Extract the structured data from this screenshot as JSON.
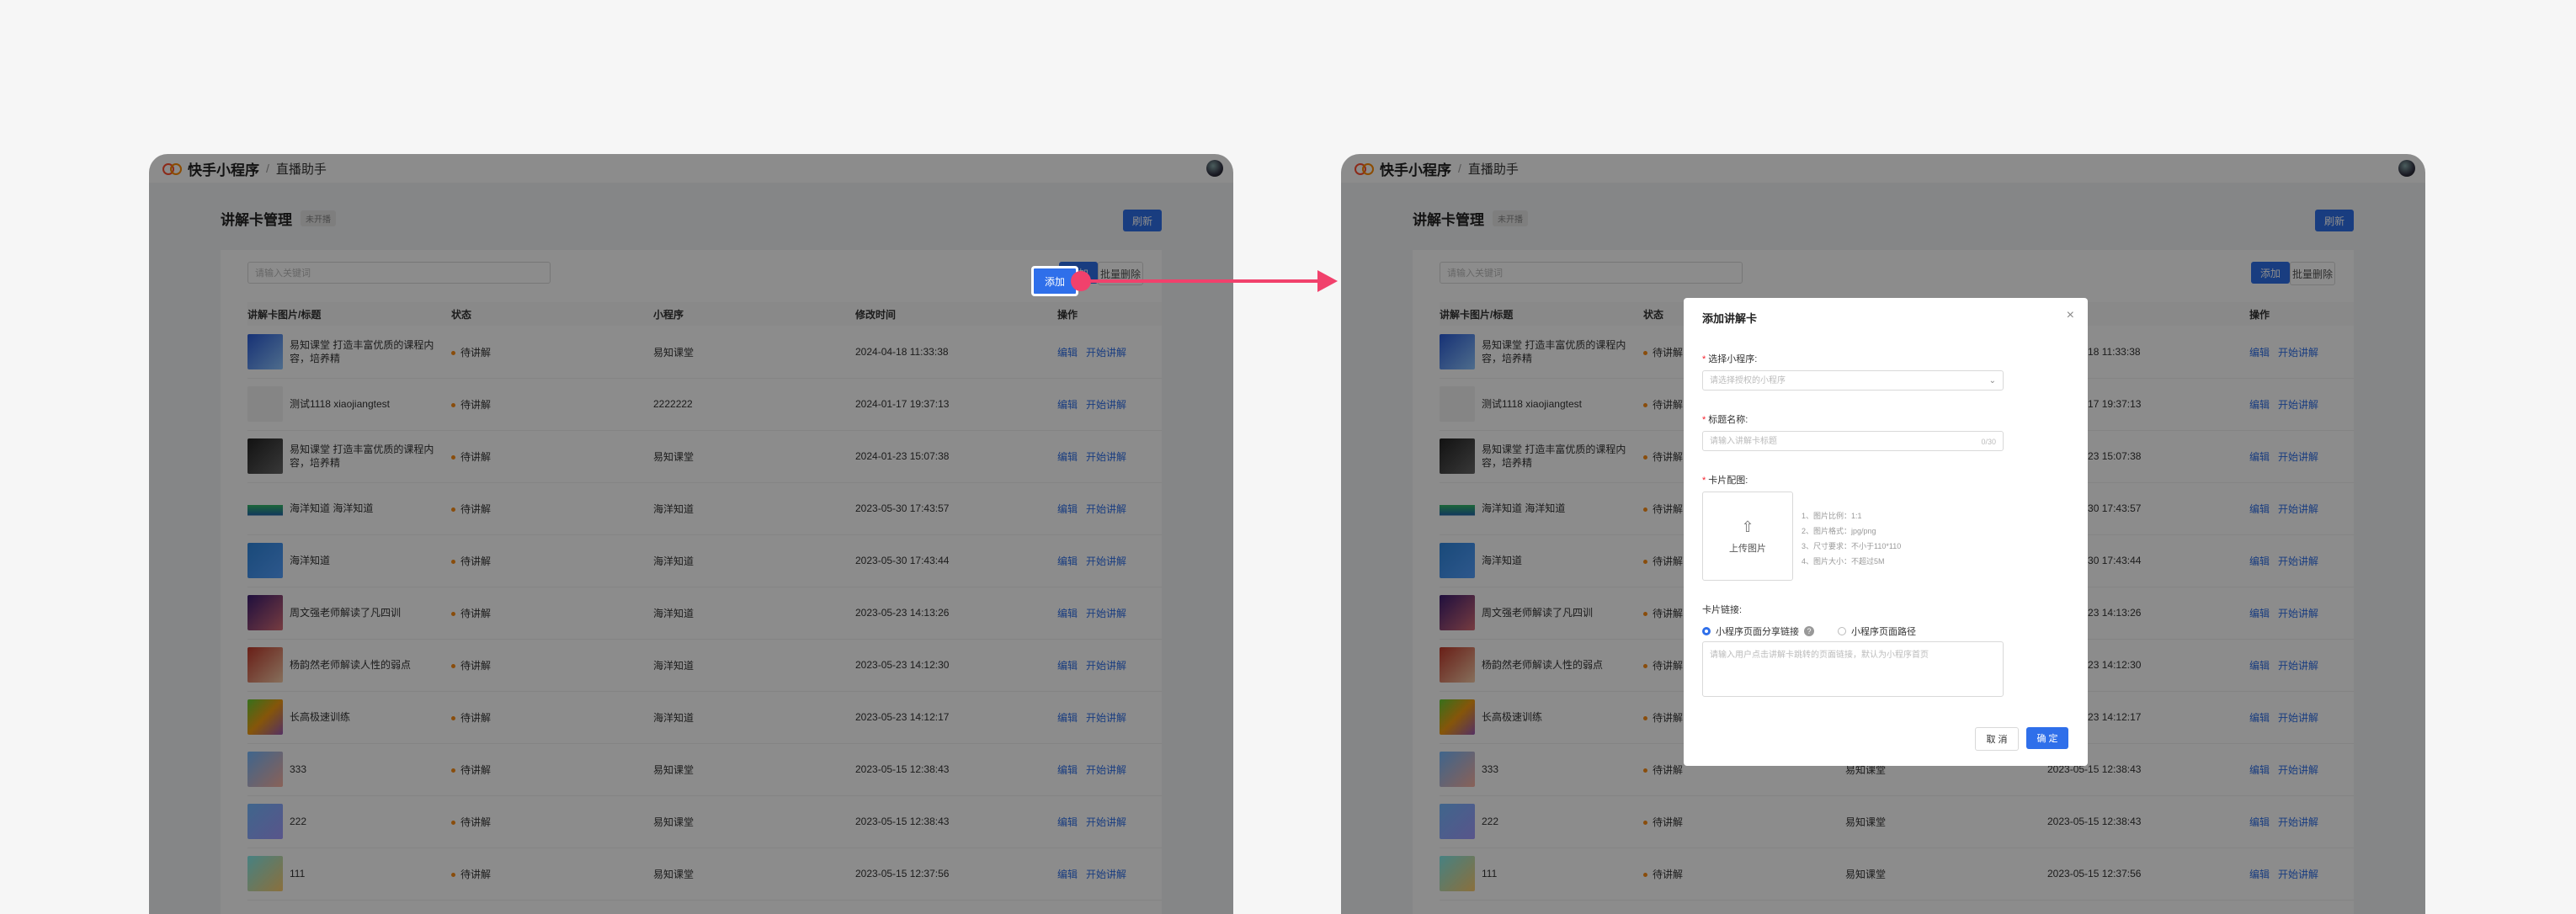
{
  "app": {
    "name": "快手小程序",
    "crumb": "直播助手"
  },
  "page": {
    "title": "讲解卡管理",
    "tag": "未开播",
    "refresh": "刷新"
  },
  "toolbar": {
    "search_placeholder": "请输入关键词",
    "add": "添加",
    "batch_delete": "批量删除"
  },
  "table": {
    "headers": [
      "讲解卡图片/标题",
      "状态",
      "小程序",
      "修改时间",
      "操作"
    ],
    "actions": [
      "编辑",
      "开始讲解"
    ],
    "rows": [
      {
        "title": "易知课堂 打造丰富优质的课程内容，培养精",
        "status": "待讲解",
        "app": "易知课堂",
        "time": "2024-04-18 11:33:38"
      },
      {
        "title": "测试1118 xiaojiangtest",
        "status": "待讲解",
        "app": "2222222",
        "time": "2024-01-17 19:37:13"
      },
      {
        "title": "易知课堂 打造丰富优质的课程内容，培养精",
        "status": "待讲解",
        "app": "易知课堂",
        "time": "2024-01-23 15:07:38"
      },
      {
        "title": "海洋知道 海洋知道",
        "status": "待讲解",
        "app": "海洋知道",
        "time": "2023-05-30 17:43:57"
      },
      {
        "title": "海洋知道",
        "status": "待讲解",
        "app": "海洋知道",
        "time": "2023-05-30 17:43:44"
      },
      {
        "title": "周文强老师解读了凡四训",
        "status": "待讲解",
        "app": "海洋知道",
        "time": "2023-05-23 14:13:26"
      },
      {
        "title": "杨韵然老师解读人性的弱点",
        "status": "待讲解",
        "app": "海洋知道",
        "time": "2023-05-23 14:12:30"
      },
      {
        "title": "长高极速训练",
        "status": "待讲解",
        "app": "海洋知道",
        "time": "2023-05-23 14:12:17"
      },
      {
        "title": "333",
        "status": "待讲解",
        "app": "易知课堂",
        "time": "2023-05-15 12:38:43"
      },
      {
        "title": "222",
        "status": "待讲解",
        "app": "易知课堂",
        "time": "2023-05-15 12:38:43"
      },
      {
        "title": "111",
        "status": "待讲解",
        "app": "易知课堂",
        "time": "2023-05-15 12:37:56"
      }
    ]
  },
  "modal": {
    "title": "添加讲解卡",
    "close": "×",
    "select_label": "选择小程序:",
    "select_placeholder": "请选择授权的小程序",
    "name_label": "标题名称:",
    "name_placeholder": "请输入讲解卡标题",
    "name_counter": "0/30",
    "image_label": "卡片配图:",
    "upload_label": "上传图片",
    "requirements": [
      "1、图片比例：1:1",
      "2、图片格式：jpg/png",
      "3、尺寸要求：不小于110*110",
      "4、图片大小：不超过5M"
    ],
    "link_label": "卡片链接:",
    "radio_options": [
      "小程序页面分享链接",
      "小程序页面路径"
    ],
    "link_placeholder": "请输入用户点击讲解卡跳转的页面链接，默认为小程序首页",
    "cancel": "取 消",
    "confirm": "确 定"
  },
  "colors": {
    "primary": "#2f6fea",
    "arrow": "#f1416c",
    "status_dot": "#fa8c16"
  },
  "icons": [
    "avatar",
    "upload-icon",
    "help-icon",
    "chevron-down-icon",
    "close-icon",
    "arrow-right-icon"
  ]
}
